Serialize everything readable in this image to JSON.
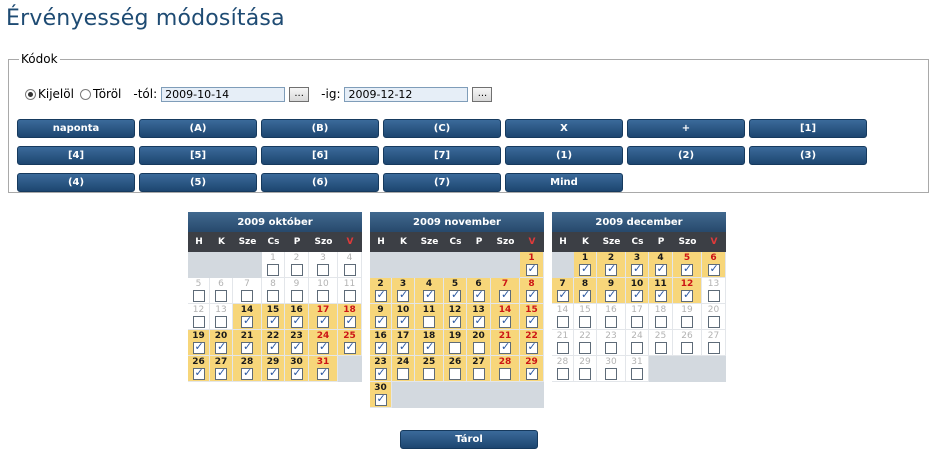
{
  "page": {
    "title": "Érvényesség módosítása"
  },
  "codes_panel": {
    "legend": "Kódok",
    "radio_select": "Kijelöl",
    "radio_delete": "Töröl",
    "from_label": "-tól:",
    "from_value": "2009-10-14",
    "to_label": "-ig:",
    "to_value": "2009-12-12",
    "picker_label": "...",
    "buttons": [
      "naponta",
      "(A)",
      "(B)",
      "(C)",
      "X",
      "+",
      "[1]",
      "[4]",
      "[5]",
      "[6]",
      "[7]",
      "(1)",
      "(2)",
      "(3)",
      "(4)",
      "(5)",
      "(6)",
      "(7)",
      "Mind"
    ]
  },
  "weekdays": [
    "H",
    "K",
    "Sze",
    "Cs",
    "P",
    "Szo",
    "V"
  ],
  "calendars": [
    {
      "title": "2009 október",
      "lead": 3,
      "days": 31,
      "active_from": 14,
      "active_to": 31,
      "unchecked": []
    },
    {
      "title": "2009 november",
      "lead": 6,
      "days": 30,
      "active_from": 1,
      "active_to": 30,
      "unchecked": [
        11,
        19,
        20,
        24,
        25,
        26,
        27,
        28
      ]
    },
    {
      "title": "2009 december",
      "lead": 1,
      "days": 31,
      "active_from": 1,
      "active_to": 12,
      "unchecked": []
    }
  ],
  "save_label": "Tárol"
}
